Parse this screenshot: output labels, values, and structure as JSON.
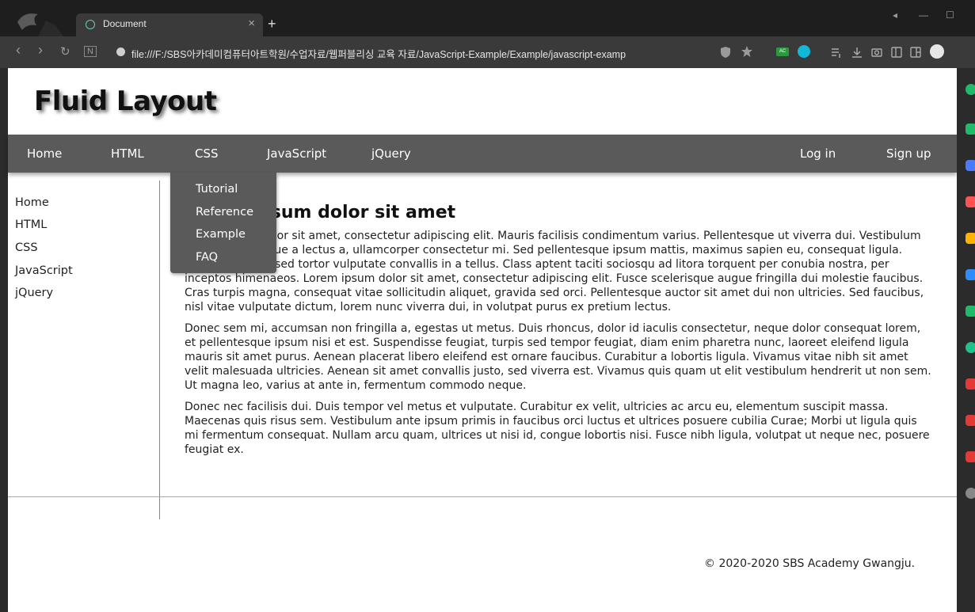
{
  "browser": {
    "tab_title": "Document",
    "tab_close": "×",
    "new_tab": "+",
    "url": "file:///F:/SBS아카데미컴퓨터아트학원/수업자료/웹퍼블리싱 교육 자료/JavaScript-Example/Example/javascript-examp",
    "window_controls": [
      "◂",
      "—",
      "☐"
    ],
    "nav_icons": [
      "‹",
      "›",
      "↻",
      "N"
    ],
    "toolbar_icons": [
      "shield-icon",
      "star-icon",
      "ac-extension-icon",
      "q-extension-icon",
      "playlist-icon",
      "download-icon",
      "camera-icon",
      "sidebar-icon",
      "split-view-icon",
      "profile-icon"
    ]
  },
  "site": {
    "title": "Fluid Layout",
    "nav": {
      "left": [
        "Home",
        "HTML",
        "CSS",
        "JavaScript",
        "jQuery"
      ],
      "right": [
        "Log in",
        "Sign up"
      ]
    },
    "dropdown": [
      "Tutorial",
      "Reference",
      "Example",
      "FAQ"
    ],
    "sidebar": [
      "Home",
      "HTML",
      "CSS",
      "JavaScript",
      "jQuery"
    ],
    "article": {
      "title": "Lorem ipsum dolor sit amet",
      "paragraphs": [
        "Lorem ipsum dolor sit amet, consectetur adipiscing elit. Mauris facilisis condimentum varius. Pellentesque ut viverra dui. Vestibulum ipsum, scelerisque a lectus a, ullamcorper consectetur mi. Sed pellentesque ipsum mattis, maximus sapien eu, consequat ligula. Donec non odio sed tortor vulputate convallis in a tellus. Class aptent taciti sociosqu ad litora torquent per conubia nostra, per inceptos himenaeos. Lorem ipsum dolor sit amet, consectetur adipiscing elit. Fusce scelerisque augue fringilla dui molestie faucibus. Cras turpis magna, consequat vitae sollicitudin aliquet, gravida sed orci. Pellentesque auctor sit amet dui non ultricies. Sed faucibus, nisl vitae vulputate dictum, lorem nunc viverra dui, in volutpat purus ex pretium lectus.",
        "Donec sem mi, accumsan non fringilla a, egestas ut metus. Duis rhoncus, dolor id iaculis consectetur, neque dolor consequat lorem, et pellentesque ipsum nisi et est. Suspendisse feugiat, turpis sed tempor feugiat, diam enim pharetra nunc, laoreet eleifend ligula mauris sit amet purus. Aenean placerat libero eleifend est ornare faucibus. Curabitur a lobortis ligula. Vivamus vitae nibh sit amet velit malesuada ultricies. Aenean sit amet convallis justo, sed viverra est. Vivamus quis quam ut elit vestibulum hendrerit ut non sem. Ut magna leo, varius at ante in, fermentum commodo neque.",
        "Donec nec facilisis dui. Duis tempor vel metus et vulputate. Curabitur ex velit, ultricies ac arcu eu, elementum suscipit massa. Maecenas quis risus sem. Vestibulum ante ipsum primis in faucibus orci luctus et ultrices posuere cubilia Curae; Morbi ut ligula quis mi fermentum consequat. Nullam arcu quam, ultrices ut nisi id, congue lobortis nisi. Fusce nibh ligula, volutpat ut neque nec, posuere feugiat ex."
      ]
    },
    "footer": "© 2020-2020 SBS Academy Gwangju."
  },
  "colors": {
    "nav_bg": "#5a5a5a",
    "chrome_bg": "#3a3a3a",
    "tab_ring": "#6fc7c0",
    "rail_icons": [
      "#1fba6a",
      "#1fba6a",
      "#4a7bff",
      "#ff5252",
      "#ffb300",
      "#2d8cff",
      "#1fba6a",
      "#1ec28b",
      "#e53935",
      "#e53935",
      "#e53935",
      "#888888"
    ]
  }
}
